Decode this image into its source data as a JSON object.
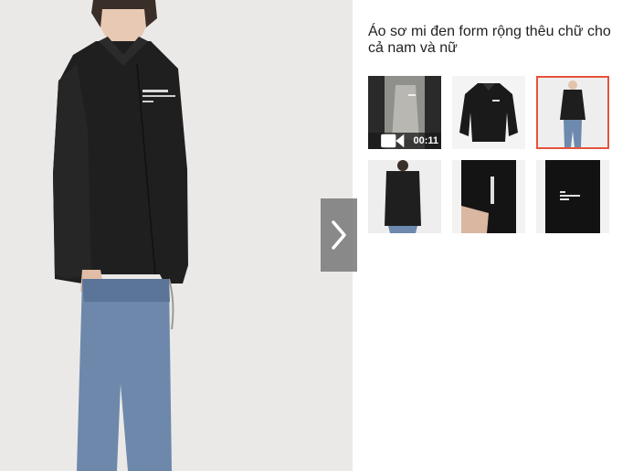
{
  "product": {
    "title": "Áo sơ mi đen form rộng thêu chữ cho cả nam và nữ"
  },
  "gallery": {
    "next_icon": "chevron-right-icon",
    "accent_color": "#e5533b",
    "thumbnails": [
      {
        "id": "video",
        "type": "video",
        "duration": "00:11",
        "selected": false
      },
      {
        "id": "flat",
        "type": "image",
        "selected": false
      },
      {
        "id": "front-model",
        "type": "image",
        "selected": true
      },
      {
        "id": "back-model",
        "type": "image",
        "selected": false
      },
      {
        "id": "sleeve-detail",
        "type": "image",
        "selected": false
      },
      {
        "id": "chest-embroidery",
        "type": "image",
        "selected": false
      }
    ]
  }
}
